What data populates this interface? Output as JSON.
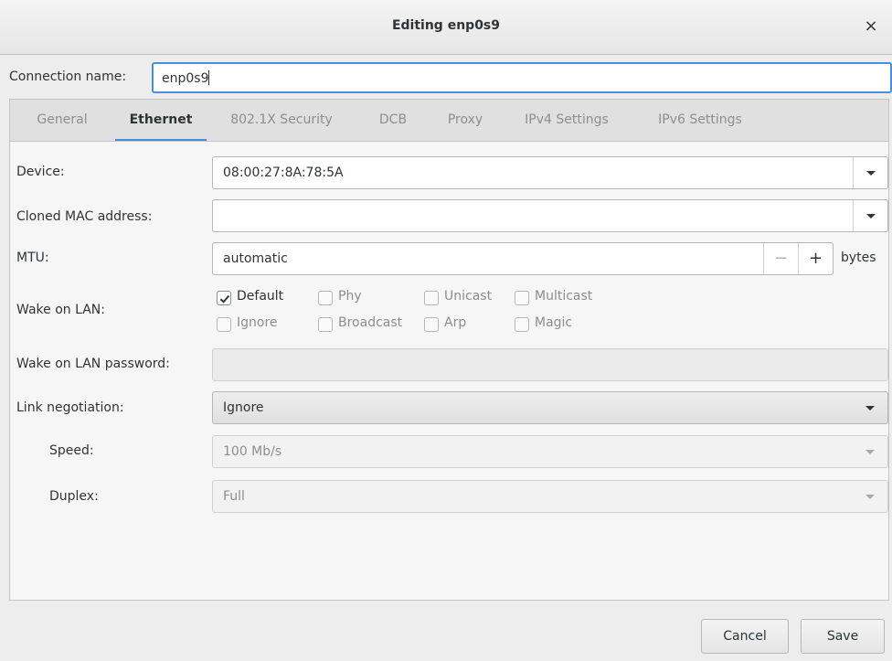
{
  "window": {
    "title": "Editing enp0s9",
    "close_glyph": "×"
  },
  "connection": {
    "label": "Connection name:",
    "value": "enp0s9"
  },
  "tabs": [
    {
      "label": "General",
      "active": false
    },
    {
      "label": "Ethernet",
      "active": true
    },
    {
      "label": "802.1X Security",
      "active": false
    },
    {
      "label": "DCB",
      "active": false
    },
    {
      "label": "Proxy",
      "active": false
    },
    {
      "label": "IPv4 Settings",
      "active": false
    },
    {
      "label": "IPv6 Settings",
      "active": false
    }
  ],
  "ethernet": {
    "device": {
      "label": "Device:",
      "value": "08:00:27:8A:78:5A"
    },
    "cloned_mac": {
      "label": "Cloned MAC address:",
      "value": ""
    },
    "mtu": {
      "label": "MTU:",
      "value": "automatic",
      "minus": "−",
      "plus": "+",
      "unit": "bytes"
    },
    "wake_on_lan": {
      "label": "Wake on LAN:",
      "options": [
        {
          "label": "Default",
          "checked": true
        },
        {
          "label": "Phy",
          "checked": false
        },
        {
          "label": "Unicast",
          "checked": false
        },
        {
          "label": "Multicast",
          "checked": false
        },
        {
          "label": "Ignore",
          "checked": false
        },
        {
          "label": "Broadcast",
          "checked": false
        },
        {
          "label": "Arp",
          "checked": false
        },
        {
          "label": "Magic",
          "checked": false
        }
      ]
    },
    "wol_password": {
      "label": "Wake on LAN password:",
      "value": ""
    },
    "link_negotiation": {
      "label": "Link negotiation:",
      "value": "Ignore"
    },
    "speed": {
      "label": "Speed:",
      "value": "100 Mb/s"
    },
    "duplex": {
      "label": "Duplex:",
      "value": "Full"
    }
  },
  "footer": {
    "cancel_label": "Cancel",
    "save_label": "Save"
  },
  "colors": {
    "accent": "#4a90d9",
    "text": "#2e3436",
    "disabled_text": "#8b8e8f",
    "background": "#ededed"
  }
}
